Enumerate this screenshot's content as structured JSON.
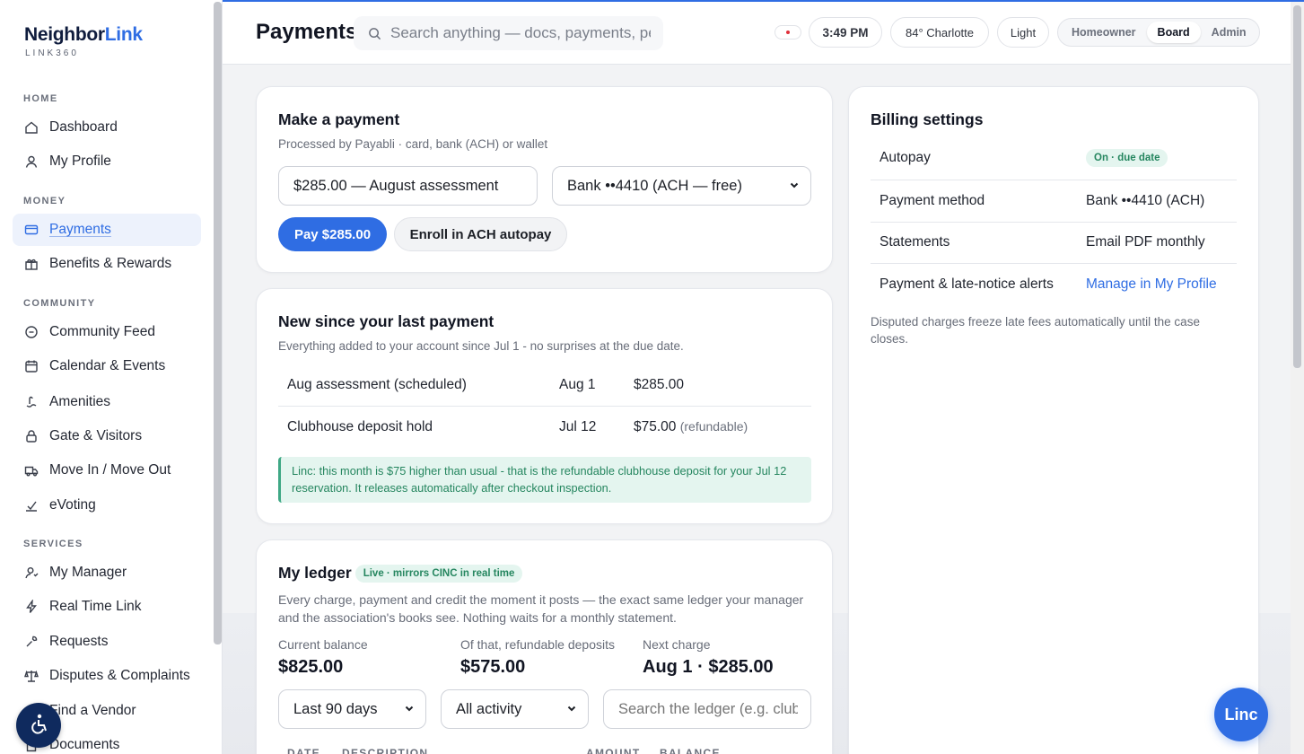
{
  "brand": {
    "name_main": "Neighbor",
    "name_accent": "Link",
    "tagline": "LINK360"
  },
  "sidebar": {
    "sections": [
      {
        "label": "HOME"
      },
      {
        "label": "MONEY"
      },
      {
        "label": "COMMUNITY"
      },
      {
        "label": "SERVICES"
      }
    ],
    "items": [
      {
        "label": "Dashboard",
        "icon": "home-icon"
      },
      {
        "label": "My Profile",
        "icon": "user-icon"
      },
      {
        "label": "Payments",
        "icon": "card-icon",
        "active": true
      },
      {
        "label": "Benefits & Rewards",
        "icon": "gift-icon"
      },
      {
        "label": "Community Feed",
        "icon": "chat-icon"
      },
      {
        "label": "Calendar & Events",
        "icon": "calendar-icon"
      },
      {
        "label": "Amenities",
        "icon": "amenity-icon"
      },
      {
        "label": "Gate & Visitors",
        "icon": "lock-icon"
      },
      {
        "label": "Move In / Move Out",
        "icon": "truck-icon"
      },
      {
        "label": "eVoting",
        "icon": "vote-icon"
      },
      {
        "label": "My Manager",
        "icon": "manager-icon"
      },
      {
        "label": "Real Time Link",
        "icon": "bolt-icon"
      },
      {
        "label": "Requests",
        "icon": "wrench-icon"
      },
      {
        "label": "Disputes & Complaints",
        "icon": "scale-icon"
      },
      {
        "label": "Find a Vendor",
        "icon": "search-vendor-icon"
      },
      {
        "label": "Documents",
        "icon": "document-icon"
      }
    ]
  },
  "header": {
    "title": "Payments",
    "search_placeholder": "Search anything — docs, payments, people",
    "time": "3:49 PM",
    "weather": "84° Charlotte",
    "theme": "Light",
    "roles": [
      "Homeowner",
      "Board",
      "Admin"
    ],
    "selected_role": "Board"
  },
  "make_payment": {
    "title": "Make a payment",
    "subtitle": "Processed by Payabli · card, bank (ACH) or wallet",
    "amount_value": "$285.00 — August assessment",
    "method_value": "Bank ••4410 (ACH — free)",
    "pay_button": "Pay $285.00",
    "autopay_button": "Enroll in ACH autopay"
  },
  "new_since": {
    "title": "New since your last payment",
    "subtitle": "Everything added to your account since Jul 1 - no surprises at the due date.",
    "rows": [
      {
        "desc": "Aug assessment (scheduled)",
        "date": "Aug 1",
        "amount": "$285.00",
        "note": ""
      },
      {
        "desc": "Clubhouse deposit hold",
        "date": "Jul 12",
        "amount": "$75.00",
        "note": "(refundable)"
      }
    ],
    "linc_note": "Linc: this month is $75 higher than usual - that is the refundable clubhouse deposit for your Jul 12 reservation. It releases automatically after checkout inspection."
  },
  "ledger": {
    "title": "My ledger",
    "badge": "Live · mirrors CINC in real time",
    "description": "Every charge, payment and credit the moment it posts — the exact same ledger your manager and the association's books see. Nothing waits for a monthly statement.",
    "stats": [
      {
        "label": "Current balance",
        "value": "$825.00"
      },
      {
        "label": "Of that, refundable deposits",
        "value": "$575.00"
      },
      {
        "label": "Next charge",
        "value": "Aug 1 · $285.00"
      }
    ],
    "range_value": "Last 90 days",
    "activity_value": "All activity",
    "search_placeholder": "Search the ledger (e.g. clubhouse)",
    "columns": [
      "DATE",
      "DESCRIPTION",
      "AMOUNT",
      "BALANCE"
    ]
  },
  "billing": {
    "title": "Billing settings",
    "rows": [
      {
        "label": "Autopay",
        "value": "On · due date"
      },
      {
        "label": "Payment method",
        "value": "Bank ••4410 (ACH)"
      },
      {
        "label": "Statements",
        "value": "Email PDF monthly"
      },
      {
        "label": "Payment & late-notice alerts",
        "value": "Manage in My Profile"
      }
    ],
    "footnote": "Disputed charges freeze late fees automatically until the case closes."
  },
  "assistant": {
    "label": "Linc"
  },
  "colors": {
    "accent": "#2f6de3",
    "success": "#25865f",
    "navy": "#0f1c3d"
  }
}
